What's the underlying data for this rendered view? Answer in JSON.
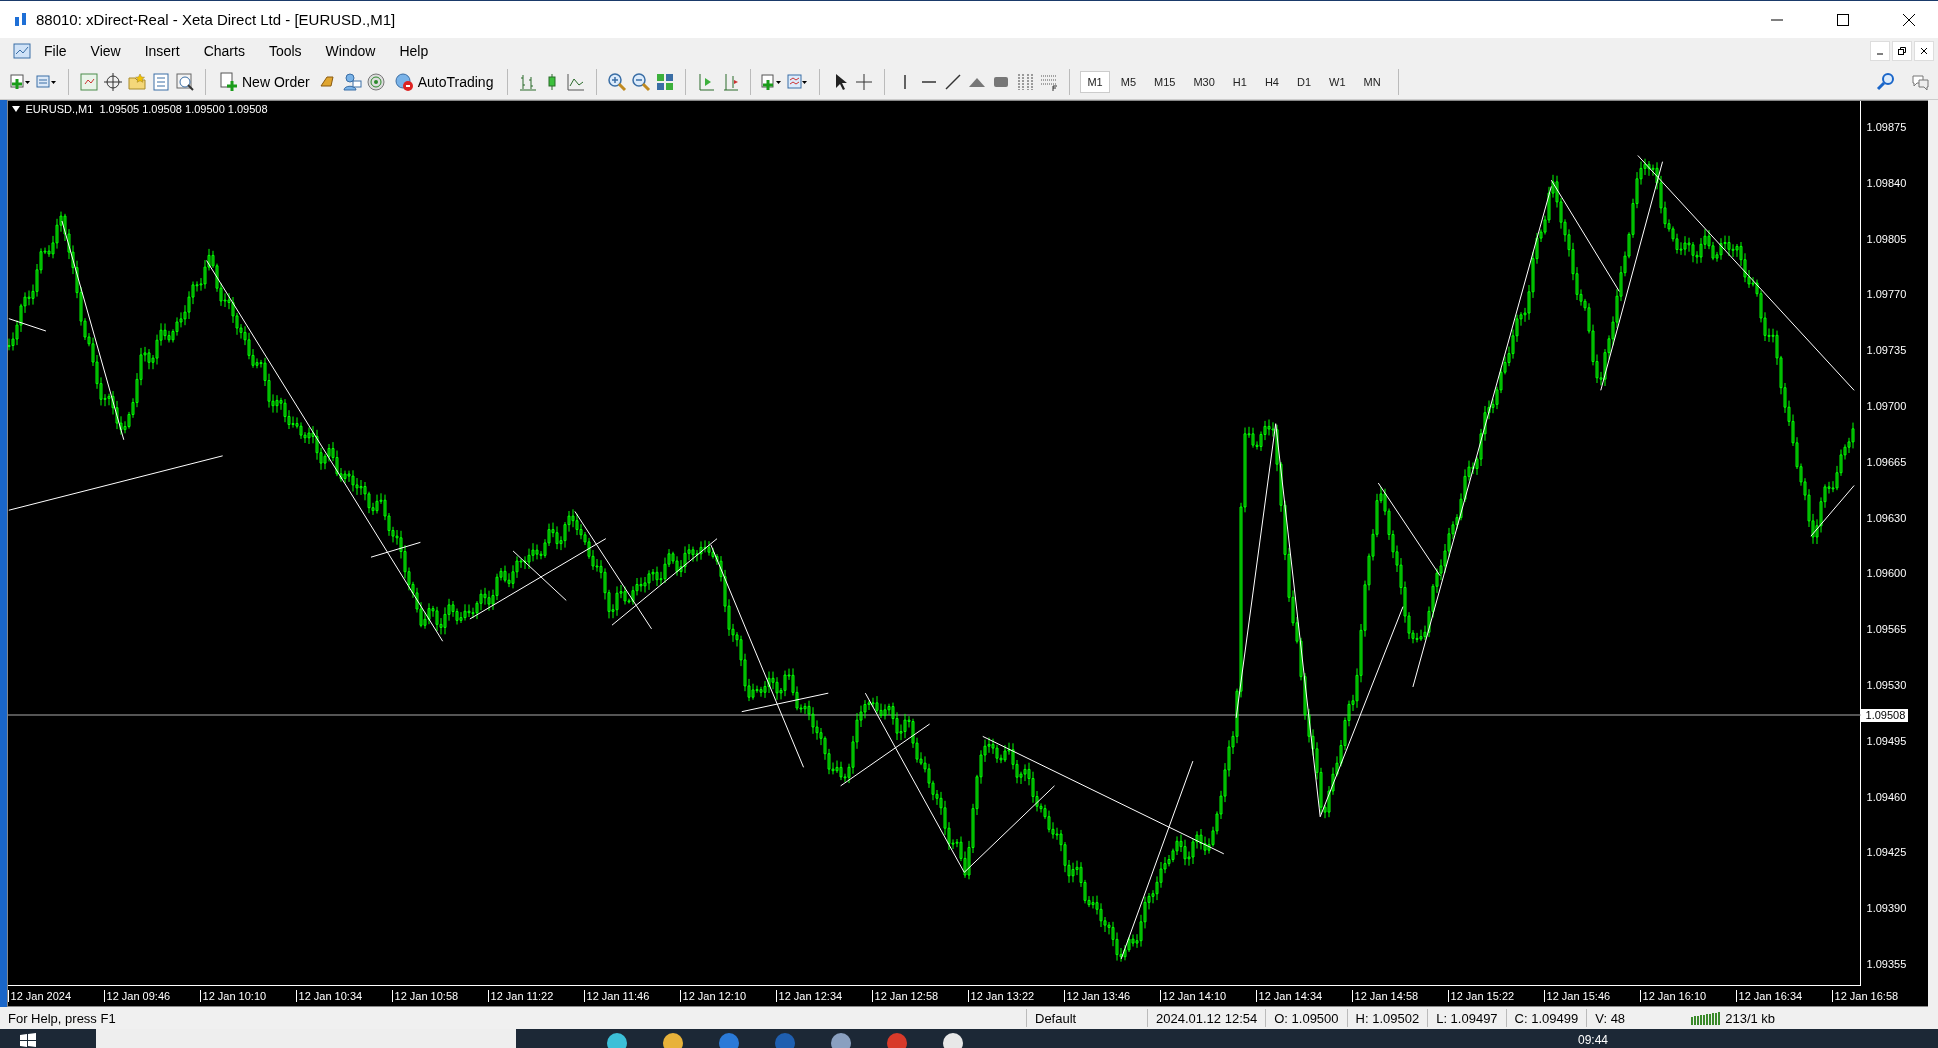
{
  "window": {
    "title": "88010: xDirect-Real - Xeta Direct Ltd - [EURUSD.,M1]"
  },
  "menu": [
    "File",
    "View",
    "Insert",
    "Charts",
    "Tools",
    "Window",
    "Help"
  ],
  "toolbar": {
    "new_order": "New Order",
    "auto_trading": "AutoTrading",
    "timeframes": [
      {
        "label": "M1",
        "selected": true
      },
      {
        "label": "M5",
        "selected": false
      },
      {
        "label": "M15",
        "selected": false
      },
      {
        "label": "M30",
        "selected": false
      },
      {
        "label": "H1",
        "selected": false
      },
      {
        "label": "H4",
        "selected": false
      },
      {
        "label": "D1",
        "selected": false
      },
      {
        "label": "W1",
        "selected": false
      },
      {
        "label": "MN",
        "selected": false
      }
    ]
  },
  "chart": {
    "symbol": "EURUSD.,M1",
    "ohlc": "1.09505 1.09508 1.09500 1.09508",
    "price_axis": [
      "1.09875",
      "1.09840",
      "1.09805",
      "1.09770",
      "1.09735",
      "1.09700",
      "1.09665",
      "1.09630",
      "1.09600",
      "1.09565",
      "1.09530",
      "1.09495",
      "1.09460",
      "1.09425",
      "1.09390",
      "1.09355"
    ],
    "current_price": "1.09508",
    "time_axis": [
      "12 Jan 2024",
      "12 Jan 09:46",
      "12 Jan 10:10",
      "12 Jan 10:34",
      "12 Jan 10:58",
      "12 Jan 11:22",
      "12 Jan 11:46",
      "12 Jan 12:10",
      "12 Jan 12:34",
      "12 Jan 12:58",
      "12 Jan 13:22",
      "12 Jan 13:46",
      "12 Jan 14:10",
      "12 Jan 14:34",
      "12 Jan 14:58",
      "12 Jan 15:22",
      "12 Jan 15:46",
      "12 Jan 16:10",
      "12 Jan 16:34",
      "12 Jan 16:58"
    ]
  },
  "status_bar": {
    "help": "For Help, press F1",
    "profile": "Default",
    "time": "2024.01.12 12:54",
    "open": "O: 1.09500",
    "high": "H: 1.09502",
    "low": "L: 1.09497",
    "close": "C: 1.09499",
    "volume": "V: 48",
    "traffic": "213/1 kb"
  },
  "taskbar": {
    "clock": "09:44"
  }
}
